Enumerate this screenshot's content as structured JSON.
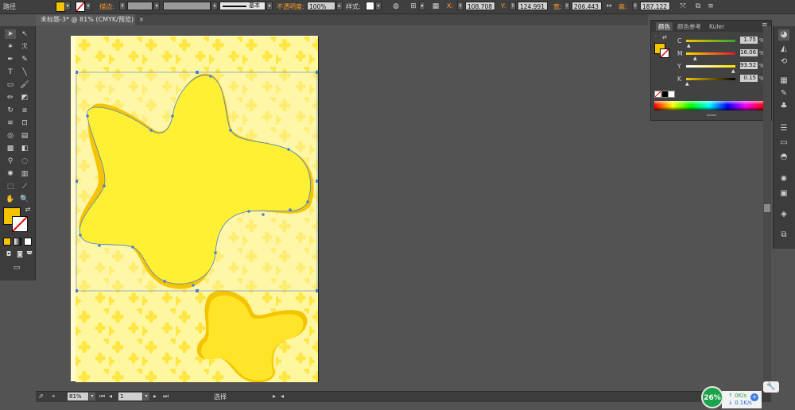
{
  "control_bar": {
    "object_type": "路径",
    "stroke_label": "描边:",
    "stroke_profile": "基本",
    "opacity_label": "不透明度:",
    "opacity_value": "100%",
    "style_label": "样式:",
    "x_label": "X:",
    "x_value": "108.708",
    "y_label": "Y:",
    "y_value": "124.991",
    "w_label": "宽:",
    "w_value": "206.443",
    "h_label": "高:",
    "h_value": "187.122",
    "fill_color": "#f5c400"
  },
  "document_tab": {
    "title": "未标题-3* @ 81% (CMYK/预览)"
  },
  "color_panel": {
    "tabs": [
      "颜色",
      "颜色参考",
      "Kuler"
    ],
    "channels": [
      {
        "name": "C",
        "value": "1.75",
        "unit": "%",
        "fraction": 0.02
      },
      {
        "name": "M",
        "value": "16.06",
        "unit": "%",
        "fraction": 0.16
      },
      {
        "name": "Y",
        "value": "93.52",
        "unit": "%",
        "fraction": 0.94
      },
      {
        "name": "K",
        "value": "0.15",
        "unit": "%",
        "fraction": 0.0
      }
    ]
  },
  "status_bar": {
    "zoom": "81%",
    "page": "1",
    "tool_name": "选择"
  },
  "network": {
    "percent": "26%",
    "up": "0K/s",
    "down": "0.1K/s"
  },
  "colors": {
    "fill": "#f5c400",
    "shape_light": "#ffee33",
    "shape_dark": "#f5c400",
    "background_flowers": "#ffe84d",
    "artboard": "#fff6a8",
    "selection": "#4a7fd4"
  }
}
